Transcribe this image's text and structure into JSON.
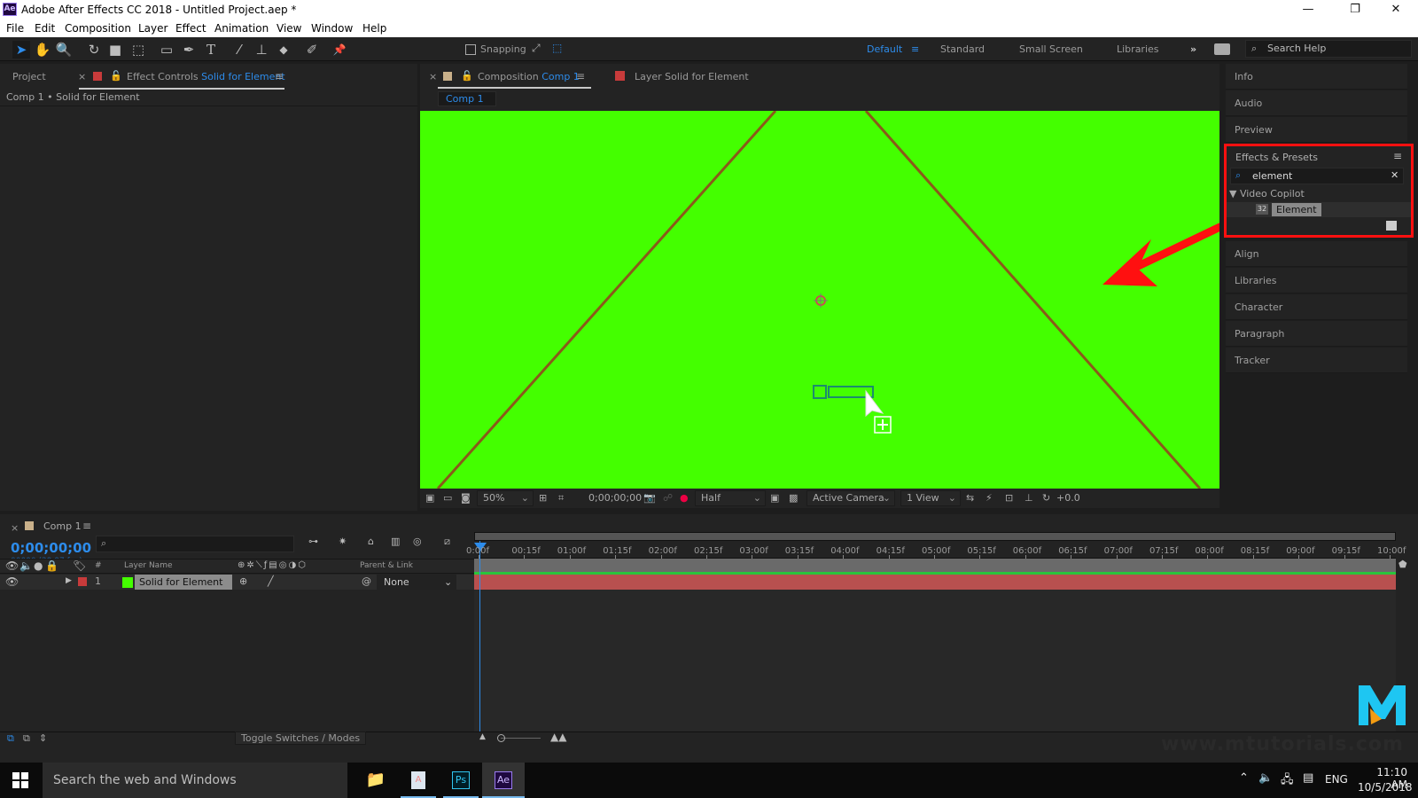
{
  "window": {
    "title": "Adobe After Effects CC 2018 - Untitled Project.aep *",
    "app_icon": "Ae",
    "controls": {
      "minimize": "—",
      "restore": "❐",
      "close": "✕"
    }
  },
  "menu": [
    "File",
    "Edit",
    "Composition",
    "Layer",
    "Effect",
    "Animation",
    "View",
    "Window",
    "Help"
  ],
  "toolbar": {
    "tools": [
      {
        "name": "selection-tool-icon",
        "glyph": "➤",
        "active": true
      },
      {
        "name": "hand-tool-icon",
        "glyph": "✋"
      },
      {
        "name": "zoom-tool-icon",
        "glyph": "🔍"
      },
      {
        "name": "rotate-tool-icon",
        "glyph": "↻"
      },
      {
        "name": "camera-tool-icon",
        "glyph": "■"
      },
      {
        "name": "pan-behind-tool-icon",
        "glyph": "⬚"
      },
      {
        "name": "rectangle-tool-icon",
        "glyph": "▭"
      },
      {
        "name": "pen-tool-icon",
        "glyph": "✒"
      },
      {
        "name": "type-tool-icon",
        "glyph": "T"
      },
      {
        "name": "brush-tool-icon",
        "glyph": "⁄"
      },
      {
        "name": "clone-stamp-tool-icon",
        "glyph": "⊥"
      },
      {
        "name": "eraser-tool-icon",
        "glyph": "◆"
      },
      {
        "name": "roto-brush-tool-icon",
        "glyph": "✐"
      },
      {
        "name": "puppet-pin-tool-icon",
        "glyph": "📌"
      }
    ],
    "snapping_label": "Snapping",
    "snapping_checked": false,
    "workspaces": [
      "Default",
      "Standard",
      "Small Screen",
      "Libraries"
    ],
    "active_workspace": "Default",
    "more_label": "»",
    "search_help_placeholder": "Search Help"
  },
  "left_panel": {
    "tab_project": "Project",
    "tab_effect_controls_prefix": "Effect Controls",
    "tab_effect_controls_layer": "Solid for Element",
    "breadcrumb": "Comp 1 • Solid for Element"
  },
  "comp_panel": {
    "tab_prefix": "Composition",
    "tab_name": "Comp 1",
    "layer_tab_prefix": "Layer",
    "layer_tab_name": "Solid for Element",
    "flowchart_chip": "Comp 1",
    "viewer_bg": "#44ff00",
    "viewer_toolbar": {
      "magnification": "50%",
      "timecode": "0;00;00;00",
      "resolution": "Half",
      "camera": "Active Camera",
      "views": "1 View",
      "exposure": "+0.0"
    }
  },
  "right_panel": {
    "items_top": [
      "Info",
      "Audio",
      "Preview"
    ],
    "effects_presets": {
      "title": "Effects & Presets",
      "search_value": "element",
      "category": "Video Copilot",
      "result_badge": "32",
      "result": "Element"
    },
    "items_bottom": [
      "Align",
      "Libraries",
      "Character",
      "Paragraph",
      "Tracker"
    ],
    "annotation_color": "#ff1010"
  },
  "timeline": {
    "comp_tab": "Comp 1",
    "timecode": "0;00;00;00",
    "frame_info": "00000 (29.97 fps)",
    "search_placeholder": "",
    "columns": {
      "num": "#",
      "layer_name": "Layer Name",
      "parent": "Parent & Link"
    },
    "layers": [
      {
        "num": "1",
        "name": "Solid for Element",
        "label_color": "#c83b3b",
        "swatch": "#44ff00",
        "parent": "None"
      }
    ],
    "ruler": [
      "0:00f",
      "00:15f",
      "01:00f",
      "01:15f",
      "02:00f",
      "02:15f",
      "03:00f",
      "03:15f",
      "04:00f",
      "04:15f",
      "05:00f",
      "05:15f",
      "06:00f",
      "06:15f",
      "07:00f",
      "07:15f",
      "08:00f",
      "08:15f",
      "09:00f",
      "09:15f",
      "10:00f"
    ],
    "toggle_label": "Toggle Switches / Modes"
  },
  "watermark": {
    "logo": "M",
    "text": "www.mtutorials.com"
  },
  "taskbar": {
    "search_placeholder": "Search the web and Windows",
    "apps": [
      {
        "name": "file-explorer",
        "label": "📁"
      },
      {
        "name": "app-2",
        "label": "A"
      },
      {
        "name": "photoshop",
        "label": "Ps"
      },
      {
        "name": "after-effects",
        "label": "Ae"
      }
    ],
    "language": "ENG",
    "time": "11:10 AM",
    "date": "10/5/2018"
  }
}
